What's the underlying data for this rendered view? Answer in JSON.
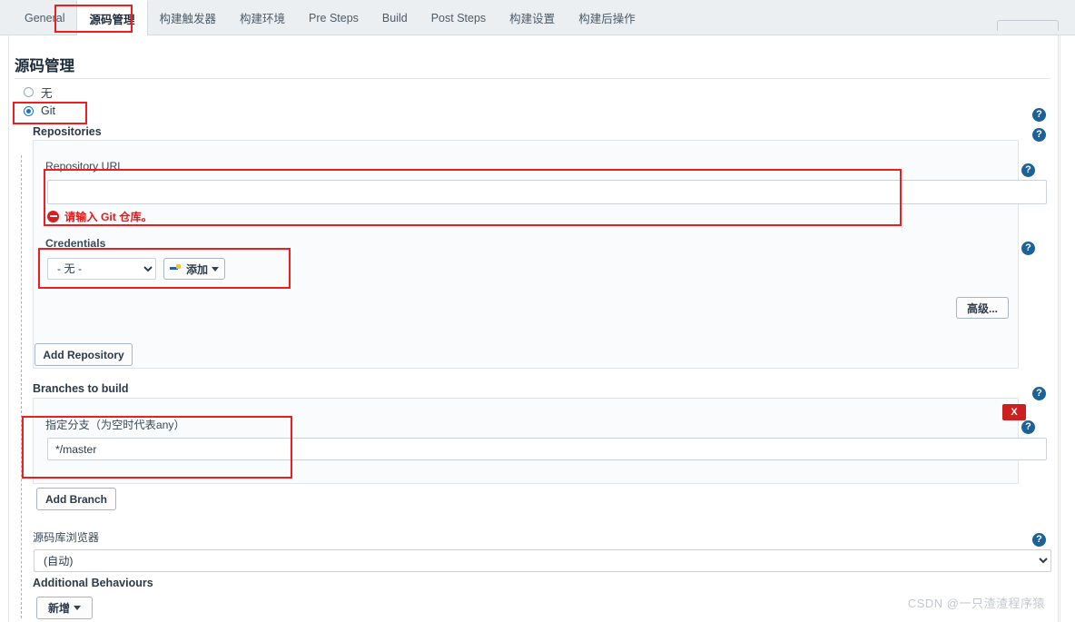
{
  "tabs": [
    {
      "label": "General",
      "active": false
    },
    {
      "label": "源码管理",
      "active": true
    },
    {
      "label": "构建触发器",
      "active": false
    },
    {
      "label": "构建环境",
      "active": false
    },
    {
      "label": "Pre Steps",
      "active": false
    },
    {
      "label": "Build",
      "active": false
    },
    {
      "label": "Post Steps",
      "active": false
    },
    {
      "label": "构建设置",
      "active": false
    },
    {
      "label": "构建后操作",
      "active": false
    }
  ],
  "page": {
    "title": "源码管理"
  },
  "scm": {
    "option_none": "无",
    "option_git": "Git",
    "selected": "Git"
  },
  "repositories": {
    "section_label": "Repositories",
    "url_label": "Repository URL",
    "url_value": "",
    "url_placeholder": "",
    "url_error": "请输入 Git 仓库。",
    "credentials_label": "Credentials",
    "credentials_value": "- 无 -",
    "credentials_options": [
      "- 无 -"
    ],
    "add_credentials_label": "添加",
    "advanced_label": "高级...",
    "add_repository_label": "Add Repository"
  },
  "branches": {
    "section_label": "Branches to build",
    "specifier_label": "指定分支（为空时代表any）",
    "specifier_value": "*/master",
    "add_branch_label": "Add Branch",
    "delete_label": "X"
  },
  "browser": {
    "label": "源码库浏览器",
    "value": "(自动)",
    "options": [
      "(自动)"
    ]
  },
  "additional": {
    "label": "Additional Behaviours",
    "add_label": "新增"
  },
  "help_icon": "?",
  "watermark": "CSDN @一只渣渣程序猿",
  "colors": {
    "accent_blue": "#1a6299",
    "annotation_red": "#ef1d1d",
    "error_red": "#e01b1b",
    "delete_red": "#cc1f1f"
  }
}
